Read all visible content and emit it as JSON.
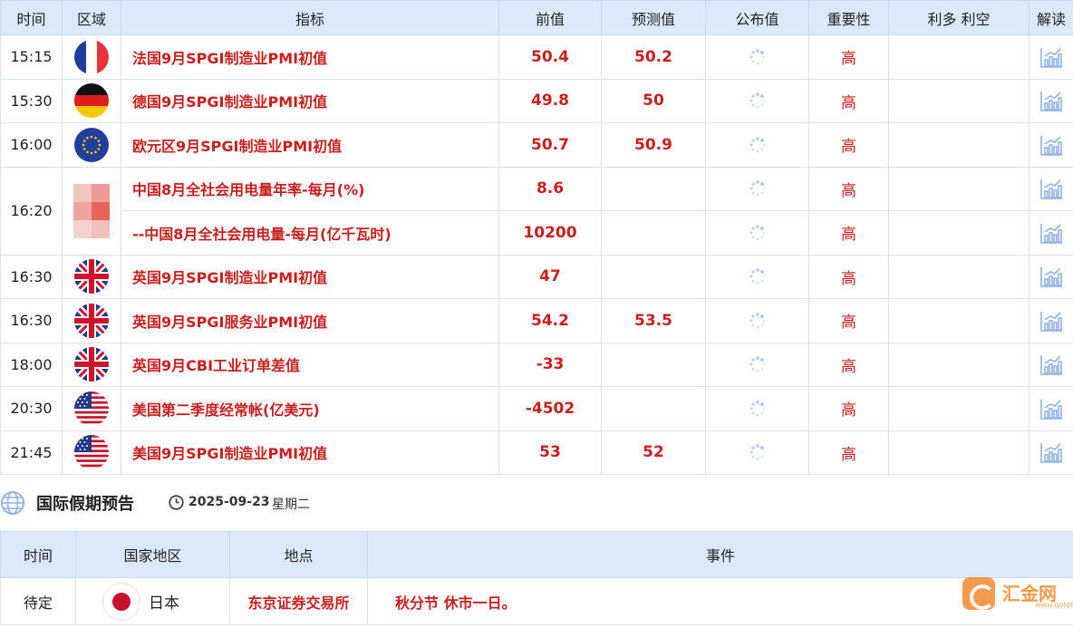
{
  "table": {
    "headers": {
      "time": "时间",
      "region": "区域",
      "indicator": "指标",
      "previous": "前值",
      "forecast": "预测值",
      "actual": "公布值",
      "importance": "重要性",
      "impact": "利多 利空",
      "analysis": "解读"
    },
    "rows": [
      {
        "time": "15:15",
        "flag": "france-flag-icon",
        "indicator": "法国9月SPGI制造业PMI初值",
        "previous": "50.4",
        "forecast": "50.2",
        "importance": "高"
      },
      {
        "time": "15:30",
        "flag": "germany-flag-icon",
        "indicator": "德国9月SPGI制造业PMI初值",
        "previous": "49.8",
        "forecast": "50",
        "importance": "高"
      },
      {
        "time": "16:00",
        "flag": "eu-flag-icon",
        "indicator": "欧元区9月SPGI制造业PMI初值",
        "previous": "50.7",
        "forecast": "50.9",
        "importance": "高"
      },
      {
        "time": "16:20",
        "flag": "blurred-flag-icon",
        "indicator": "中国8月全社会用电量年率-每月(%)",
        "previous": "8.6",
        "forecast": "",
        "importance": "高"
      },
      {
        "time": "",
        "flag": "",
        "indicator": "--中国8月全社会用电量-每月(亿千瓦时)",
        "previous": "10200",
        "forecast": "",
        "importance": "高"
      },
      {
        "time": "16:30",
        "flag": "uk-flag-icon",
        "indicator": "英国9月SPGI制造业PMI初值",
        "previous": "47",
        "forecast": "",
        "importance": "高"
      },
      {
        "time": "16:30",
        "flag": "uk-flag-icon",
        "indicator": "英国9月SPGI服务业PMI初值",
        "previous": "54.2",
        "forecast": "53.5",
        "importance": "高"
      },
      {
        "time": "18:00",
        "flag": "uk-flag-icon",
        "indicator": "英国9月CBI工业订单差值",
        "previous": "-33",
        "forecast": "",
        "importance": "高"
      },
      {
        "time": "20:30",
        "flag": "us-flag-icon",
        "indicator": "美国第二季度经常帐(亿美元)",
        "previous": "-4502",
        "forecast": "",
        "importance": "高"
      },
      {
        "time": "21:45",
        "flag": "us-flag-icon",
        "indicator": "美国9月SPGI制造业PMI初值",
        "previous": "53",
        "forecast": "52",
        "importance": "高"
      }
    ]
  },
  "holiday_section": {
    "title": "国际假期预告",
    "date": "2025-09-23",
    "weekday": "星期二",
    "headers": {
      "time": "时间",
      "country": "国家地区",
      "location": "地点",
      "event": "事件"
    },
    "rows": [
      {
        "time": "待定",
        "country": "日本",
        "location": "东京证券交易所",
        "event": "秋分节 休市一日。"
      }
    ]
  },
  "logo": {
    "name": "汇金网",
    "sub": "www.gold678.com"
  },
  "colors": {
    "accent": "#c81f1f",
    "header_bg": "#dce9fb",
    "logo": "#f08a2b"
  }
}
